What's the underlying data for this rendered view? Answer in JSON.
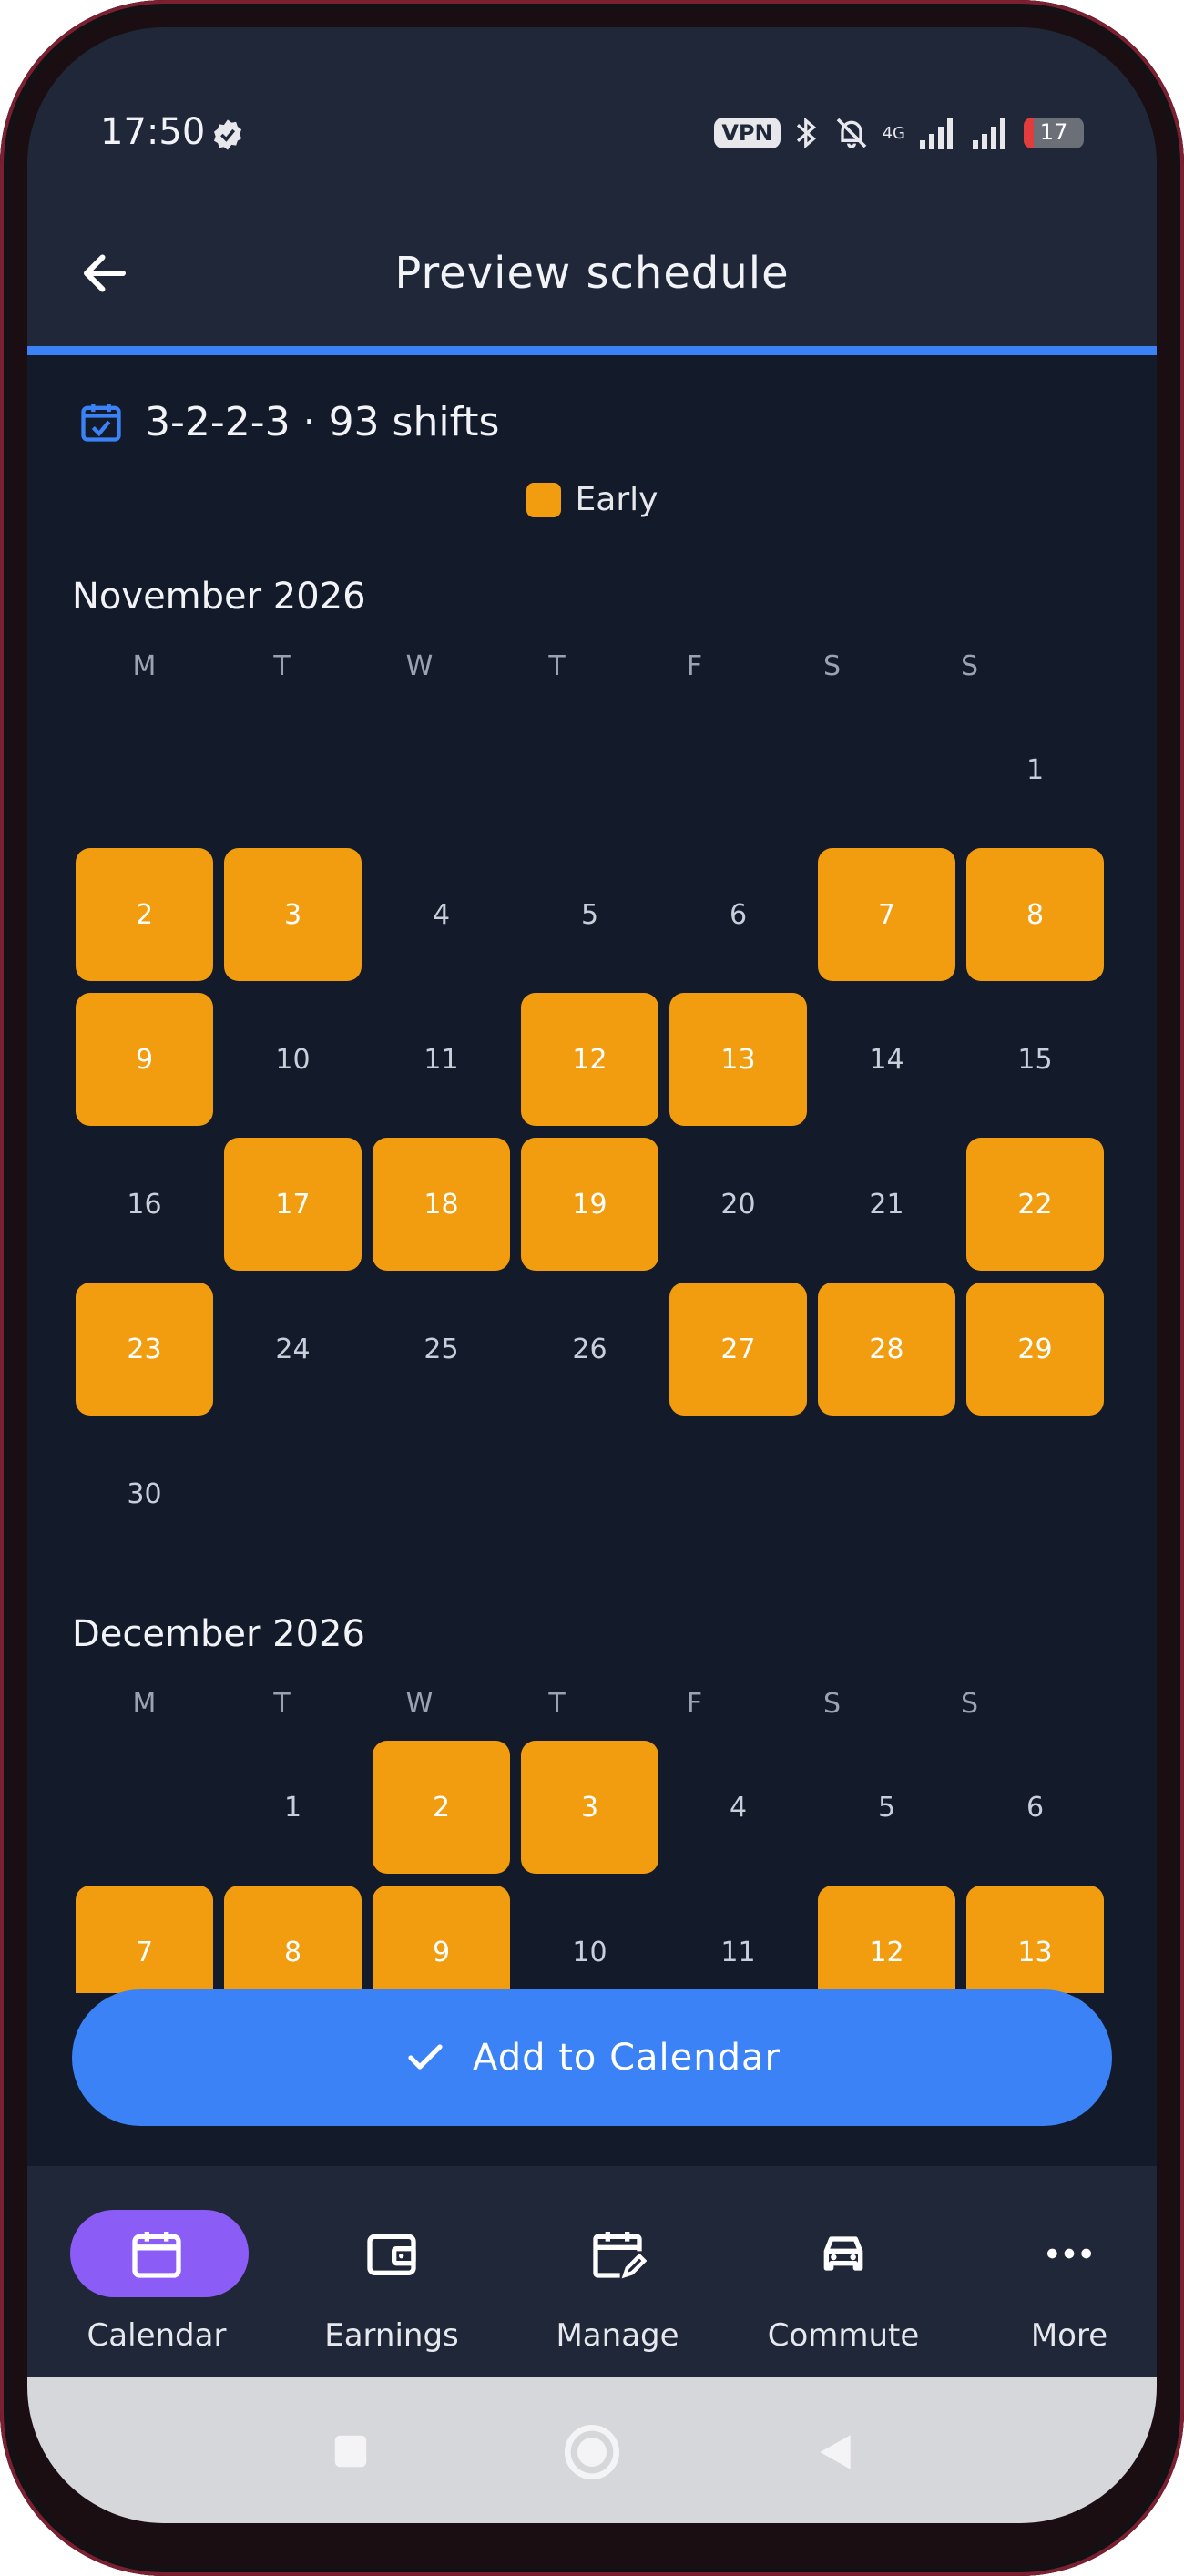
{
  "status": {
    "time": "17:50",
    "vpn": "VPN",
    "net": "4G",
    "battery": "17",
    "battery_level": 0.17
  },
  "appbar": {
    "title": "Preview schedule"
  },
  "summary": {
    "text": "3-2-2-3 · 93 shifts"
  },
  "legend": {
    "label": "Early",
    "color": "#f29d0f"
  },
  "accent": "#3b82f6",
  "weekdays": [
    "M",
    "T",
    "W",
    "T",
    "F",
    "S",
    "S"
  ],
  "months": [
    {
      "title": "November 2026",
      "days": [
        "",
        "",
        "",
        "",
        "",
        "",
        "1",
        "2",
        "3",
        "4",
        "5",
        "6",
        "7",
        "8",
        "9",
        "10",
        "11",
        "12",
        "13",
        "14",
        "15",
        "16",
        "17",
        "18",
        "19",
        "20",
        "21",
        "22",
        "23",
        "24",
        "25",
        "26",
        "27",
        "28",
        "29",
        "30"
      ],
      "shift_days": [
        "2",
        "3",
        "7",
        "8",
        "9",
        "12",
        "13",
        "17",
        "18",
        "19",
        "22",
        "23",
        "27",
        "28",
        "29"
      ]
    },
    {
      "title": "December 2026",
      "days": [
        "",
        "1",
        "2",
        "3",
        "4",
        "5",
        "6",
        "7",
        "8",
        "9",
        "10",
        "11",
        "12",
        "13"
      ],
      "shift_days": [
        "2",
        "3",
        "7",
        "8",
        "9",
        "12",
        "13"
      ]
    }
  ],
  "action": {
    "label": "Add to Calendar"
  },
  "nav": [
    {
      "label": "Calendar",
      "icon": "calendar-icon",
      "active": true
    },
    {
      "label": "Earnings",
      "icon": "wallet-icon",
      "active": false
    },
    {
      "label": "Manage",
      "icon": "calendar-edit-icon",
      "active": false
    },
    {
      "label": "Commute",
      "icon": "car-icon",
      "active": false
    },
    {
      "label": "More",
      "icon": "more-icon",
      "active": false
    }
  ]
}
